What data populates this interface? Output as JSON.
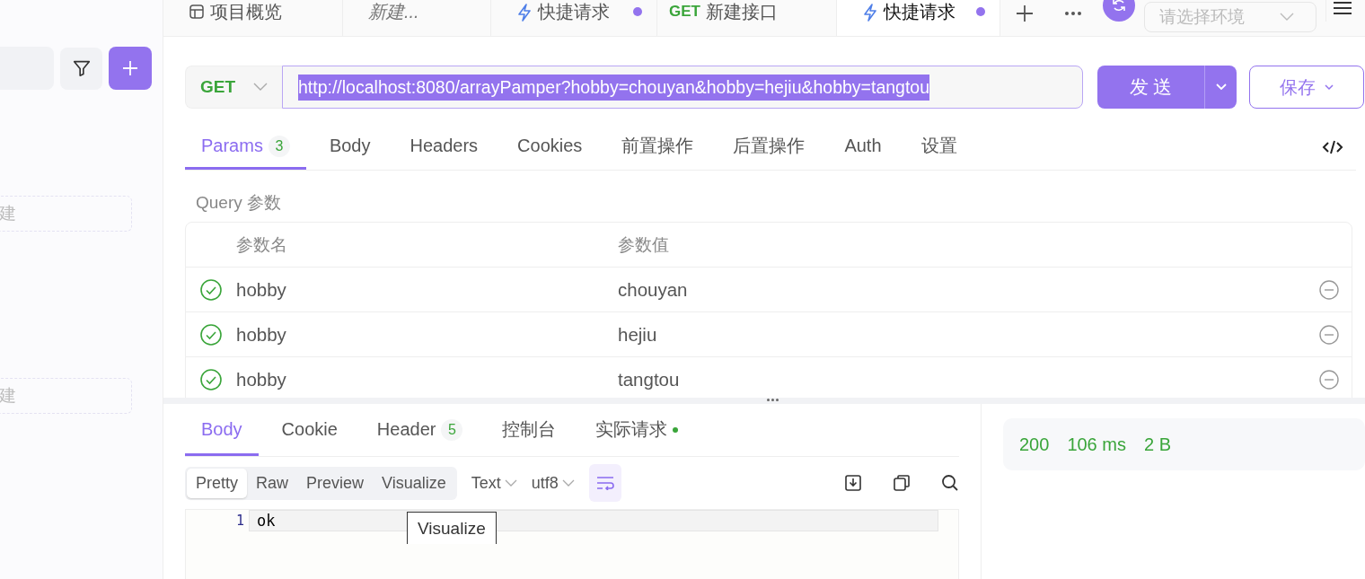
{
  "sidebar": {
    "new_items": [
      {
        "label": "建"
      },
      {
        "label": "建"
      }
    ]
  },
  "tabs": [
    {
      "kind": "overview",
      "label": "项目概览",
      "selected": false,
      "unsaved": false
    },
    {
      "kind": "draft",
      "label": "新建...",
      "selected": false,
      "unsaved": false
    },
    {
      "kind": "quick",
      "label": "快捷请求",
      "selected": false,
      "unsaved": true
    },
    {
      "kind": "api",
      "method": "GET",
      "label": "新建接口",
      "selected": false,
      "unsaved": false
    },
    {
      "kind": "quick",
      "label": "快捷请求",
      "selected": true,
      "unsaved": true
    }
  ],
  "environment": {
    "placeholder": "请选择环境"
  },
  "request": {
    "method": "GET",
    "url": "http://localhost:8080/arrayPamper?hobby=chouyan&hobby=hejiu&hobby=tangtou",
    "url_selected": true,
    "send": "发 送",
    "save": "保存"
  },
  "request_tabs": [
    {
      "label": "Params",
      "count": "3",
      "selected": true
    },
    {
      "label": "Body",
      "selected": false
    },
    {
      "label": "Headers",
      "selected": false
    },
    {
      "label": "Cookies",
      "selected": false
    },
    {
      "label": "前置操作",
      "selected": false
    },
    {
      "label": "后置操作",
      "selected": false
    },
    {
      "label": "Auth",
      "selected": false
    },
    {
      "label": "设置",
      "selected": false
    }
  ],
  "query": {
    "title": "Query 参数",
    "columns": [
      "参数名",
      "参数值"
    ],
    "rows": [
      {
        "enabled": true,
        "name": "hobby",
        "value": "chouyan"
      },
      {
        "enabled": true,
        "name": "hobby",
        "value": "hejiu"
      },
      {
        "enabled": true,
        "name": "hobby",
        "value": "tangtou"
      }
    ]
  },
  "response_tabs": [
    {
      "label": "Body",
      "selected": true
    },
    {
      "label": "Cookie",
      "selected": false
    },
    {
      "label": "Header",
      "count": "5",
      "selected": false
    },
    {
      "label": "控制台",
      "selected": false
    },
    {
      "label": "实际请求",
      "dot": true,
      "selected": false
    }
  ],
  "view_modes": [
    {
      "label": "Pretty",
      "selected": true
    },
    {
      "label": "Raw",
      "selected": false
    },
    {
      "label": "Preview",
      "selected": false
    },
    {
      "label": "Visualize",
      "selected": false
    }
  ],
  "format": "Text",
  "encoding": "utf8",
  "wrap_on": true,
  "editor": {
    "lines": [
      {
        "number": "1",
        "text": "ok"
      }
    ],
    "tooltip": "Visualize"
  },
  "status": {
    "code": "200",
    "time": "106 ms",
    "size": "2 B"
  }
}
